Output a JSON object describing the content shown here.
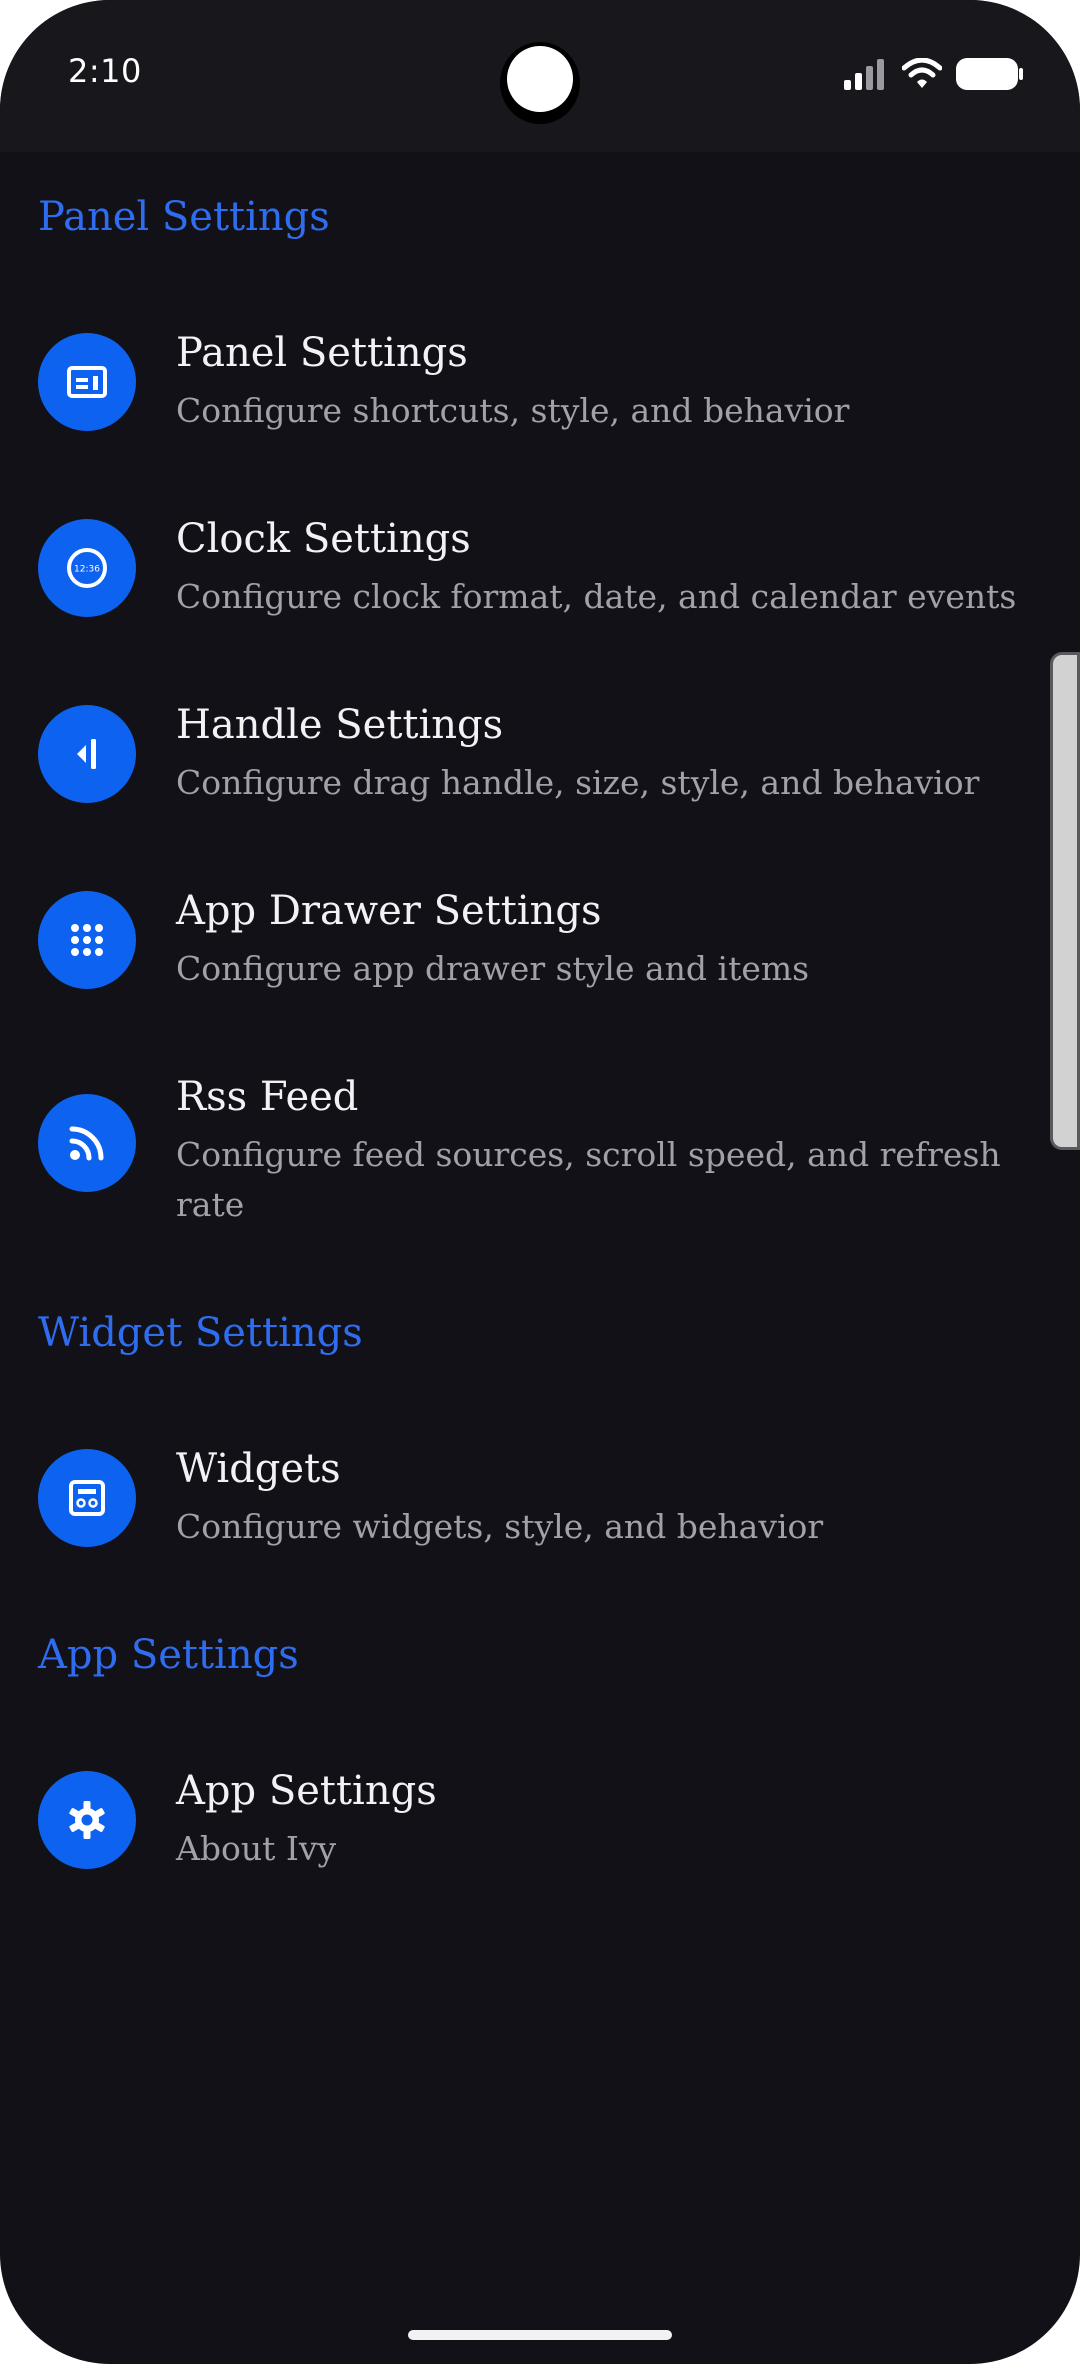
{
  "status_bar": {
    "time": "2:10"
  },
  "sections": {
    "panel": {
      "header": "Panel Settings",
      "items": [
        {
          "title": "Panel Settings",
          "subtitle": "Configure shortcuts, style, and behavior",
          "icon": "panel-icon"
        },
        {
          "title": "Clock Settings",
          "subtitle": "Configure clock format, date, and calendar events",
          "icon": "clock-icon",
          "icon_text": "12:36"
        },
        {
          "title": "Handle Settings",
          "subtitle": "Configure drag handle, size, style, and behavior",
          "icon": "handle-icon"
        },
        {
          "title": "App Drawer Settings",
          "subtitle": "Configure app drawer style and items",
          "icon": "grid-icon"
        },
        {
          "title": "Rss Feed",
          "subtitle": "Configure feed sources, scroll speed, and refresh rate",
          "icon": "rss-icon"
        }
      ]
    },
    "widget": {
      "header": "Widget Settings",
      "items": [
        {
          "title": "Widgets",
          "subtitle": "Configure widgets, style, and behavior",
          "icon": "widget-icon"
        }
      ]
    },
    "app": {
      "header": "App Settings",
      "items": [
        {
          "title": "App Settings",
          "subtitle": "About Ivy",
          "icon": "gear-icon"
        }
      ]
    }
  },
  "colors": {
    "background": "#121117",
    "accent": "#0d63f0",
    "section_header": "#2f6df0",
    "title": "#f2f2f5",
    "subtitle": "#a2a1a8"
  }
}
